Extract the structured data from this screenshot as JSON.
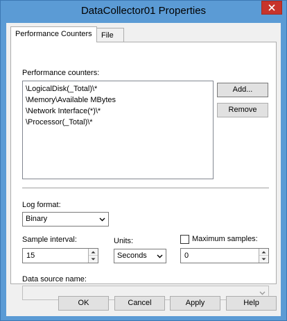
{
  "window": {
    "title": "DataCollector01 Properties"
  },
  "tabs": [
    {
      "label": "Performance Counters"
    },
    {
      "label": "File"
    }
  ],
  "counters": {
    "label": "Performance counters:",
    "items": [
      "\\LogicalDisk(_Total)\\*",
      "\\Memory\\Available MBytes",
      "\\Network Interface(*)\\*",
      "\\Processor(_Total)\\*"
    ],
    "add_label": "Add...",
    "remove_label": "Remove"
  },
  "log_format": {
    "label": "Log format:",
    "value": "Binary"
  },
  "sample_interval": {
    "label": "Sample interval:",
    "value": "15"
  },
  "units": {
    "label": "Units:",
    "value": "Seconds"
  },
  "maximum_samples": {
    "label": "Maximum samples:",
    "value": "0",
    "checked": false
  },
  "data_source": {
    "label": "Data source name:",
    "value": ""
  },
  "footer": {
    "ok_label": "OK",
    "cancel_label": "Cancel",
    "apply_label": "Apply",
    "help_label": "Help"
  },
  "colors": {
    "title_bar": "#5b9bd5",
    "close_button": "#c7342b"
  }
}
